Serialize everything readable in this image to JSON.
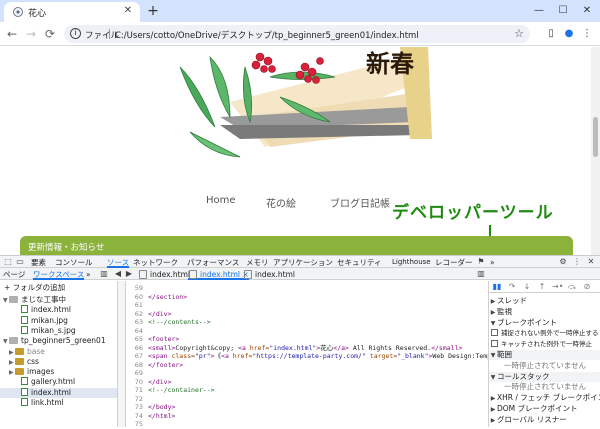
{
  "browser": {
    "tab_title": "花心",
    "tab_close": "✕",
    "new_tab": "+",
    "window_controls": [
      "—",
      "☐",
      "✕"
    ],
    "back": "←",
    "forward": "→",
    "reload": "⟳",
    "omnibox": {
      "info_icon": "i",
      "chip": "ファイル",
      "url": "C:/Users/cotto/OneDrive/デスクトップ/tp_beginner5_green01/index.html",
      "bookmark": "☆"
    },
    "toolbar_icons": [
      "▯",
      "●",
      "⋮"
    ]
  },
  "page": {
    "logo_text": "新春",
    "nav": [
      "Home",
      "花の絵",
      "ブログ日記帳"
    ],
    "news_title": "更新情報・お知らせ",
    "annotation": "デベロッパーツール"
  },
  "devtools": {
    "tabs": [
      "要素",
      "コンソール",
      "ソース",
      "ネットワーク",
      "パフォーマンス",
      "メモリ",
      "アプリケーション",
      "セキュリティ",
      "Lighthouse",
      "レコーダー"
    ],
    "active_tab": "ソース",
    "more_tabs": "»",
    "tab_badge": "⚑",
    "sub_tabs": [
      "ページ",
      "ワークスペース"
    ],
    "active_sub_tab": "ワークスペース",
    "sub_more": "»",
    "file_tabs": [
      "index.html",
      "index.html",
      "index.html"
    ],
    "active_file_tab_index": 1,
    "file_tab_close": "×",
    "tree": {
      "add_folder": "+ フォルダの追加",
      "items": [
        {
          "label": "まじな工事中",
          "kind": "folder-gray",
          "indent": 0,
          "toggle": "▼"
        },
        {
          "label": "index.html",
          "kind": "file",
          "indent": 2
        },
        {
          "label": "mikan.jpg",
          "kind": "file",
          "indent": 2
        },
        {
          "label": "mikan_s.jpg",
          "kind": "file",
          "indent": 2
        },
        {
          "label": "tp_beginner5_green01",
          "kind": "folder-gray",
          "indent": 0,
          "toggle": "▼"
        },
        {
          "label": "base",
          "kind": "folder",
          "indent": 1,
          "toggle": "▶",
          "muted": true
        },
        {
          "label": "css",
          "kind": "folder",
          "indent": 1,
          "toggle": "▶"
        },
        {
          "label": "images",
          "kind": "folder",
          "indent": 1,
          "toggle": "▶"
        },
        {
          "label": "gallery.html",
          "kind": "file",
          "indent": 2
        },
        {
          "label": "index.html",
          "kind": "file",
          "indent": 2,
          "selected": true
        },
        {
          "label": "link.html",
          "kind": "file",
          "indent": 2
        }
      ]
    },
    "code": {
      "line_numbers": [
        "59",
        "60",
        "61",
        "62",
        "63",
        "64",
        "65",
        "66",
        "67",
        "68",
        "69",
        "70",
        "71",
        "72",
        "73",
        "74",
        "75"
      ],
      "lines": [
        [],
        [
          [
            "tag",
            "</section>"
          ]
        ],
        [],
        [
          [
            "tag",
            "</div>"
          ]
        ],
        [
          [
            "cm",
            "<!--/contents-->"
          ]
        ],
        [],
        [
          [
            "tag",
            "<footer>"
          ]
        ],
        [
          [
            "tag",
            "<small>"
          ],
          [
            "txt",
            "Copyright&copy; "
          ],
          [
            "tag",
            "<a "
          ],
          [
            "atn",
            "href="
          ],
          [
            "atv",
            "\"index.html\""
          ],
          [
            "tag",
            ">"
          ],
          [
            "txt",
            "花心"
          ],
          [
            "tag",
            "</a>"
          ],
          [
            "txt",
            " All Rights Reserved."
          ],
          [
            "tag",
            "</small>"
          ]
        ],
        [
          [
            "tag",
            "<span "
          ],
          [
            "atn",
            "class="
          ],
          [
            "atv",
            "\"pr\""
          ],
          [
            "tag",
            ">"
          ],
          [
            "txt",
            "《"
          ],
          [
            "tag",
            "<a "
          ],
          [
            "atn",
            "href="
          ],
          [
            "atv",
            "\"https://template-party.com/\""
          ],
          [
            "atn",
            " target="
          ],
          [
            "atv",
            "\"_blank\""
          ],
          [
            "tag",
            ">"
          ],
          [
            "txt",
            "Web Design:Template-Par"
          ]
        ],
        [
          [
            "tag",
            "</footer>"
          ]
        ],
        [],
        [
          [
            "tag",
            "</div>"
          ]
        ],
        [
          [
            "cm",
            "<!--/container-->"
          ]
        ],
        [],
        [
          [
            "tag",
            "</body>"
          ]
        ],
        [
          [
            "tag",
            "</html>"
          ]
        ],
        []
      ]
    },
    "sidebar": {
      "debug_icons": [
        "▮▮",
        "↷",
        "↓",
        "↑",
        "→•",
        "⤼",
        "⊘"
      ],
      "sections": [
        {
          "label": "スレッド",
          "arrow": "▶",
          "header": false
        },
        {
          "label": "監視",
          "arrow": "▶",
          "header": false
        },
        {
          "label": "ブレークポイント",
          "arrow": "▼",
          "header": false
        },
        {
          "label": "捕捉されない例外で一時停止する",
          "checkbox": true
        },
        {
          "label": "キャッチされた例外で一時停止",
          "checkbox": true
        },
        {
          "label": "範囲",
          "arrow": "▼",
          "header": true
        },
        {
          "label": "一時停止されていません",
          "note": true
        },
        {
          "label": "コールスタック",
          "arrow": "▼",
          "header": true
        },
        {
          "label": "一時停止されていません",
          "note": true
        },
        {
          "label": "XHR / フェッチ ブレークポイント",
          "arrow": "▶",
          "header": false
        },
        {
          "label": "DOM ブレークポイント",
          "arrow": "▶",
          "header": false
        },
        {
          "label": "グローバル リスナー",
          "arrow": "▶",
          "header": false
        }
      ]
    },
    "top_icons": [
      "⚙",
      "⋮",
      "✕"
    ],
    "inspect_icon": "⬚",
    "device_icon": "▭"
  },
  "colors": {
    "accent": "#1a73e8",
    "tabstrip": "#d3e3fd",
    "news_bar": "#8bb23b",
    "annotation": "#1f8a10"
  }
}
